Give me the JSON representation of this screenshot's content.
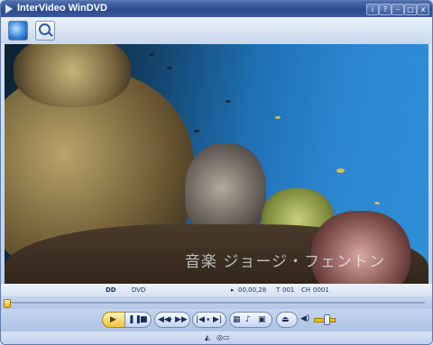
{
  "window": {
    "title": "InterVideo WinDVD",
    "buttons": [
      "i",
      "?",
      "–",
      "□",
      "x"
    ]
  },
  "toolbar": {
    "open_button": "open-disc",
    "zoom_button": "zoom"
  },
  "video": {
    "caption": "音楽 ジョージ・フェントン"
  },
  "info_bar": {
    "dolby": "DD",
    "dvd": "DVD",
    "time": "00,00,28",
    "title_prefix": "T",
    "title_number": "001",
    "chapter_prefix": "CH",
    "chapter_number": "0001"
  },
  "seek": {
    "progress": 0.0
  },
  "controls": {
    "play_icon": "play-icon",
    "pause_icon": "pause-icon",
    "stop_icon": "stop-icon",
    "rewind_icon": "rewind-icon",
    "forward_icon": "fast-forward-icon",
    "prev_icon": "previous-chapter-icon",
    "next_icon": "next-chapter-icon",
    "eject_icon": "eject-icon",
    "volume_level": 0.5
  },
  "colors": {
    "titlebar": "#2c4a8c",
    "play_button": "#f5c23a"
  }
}
